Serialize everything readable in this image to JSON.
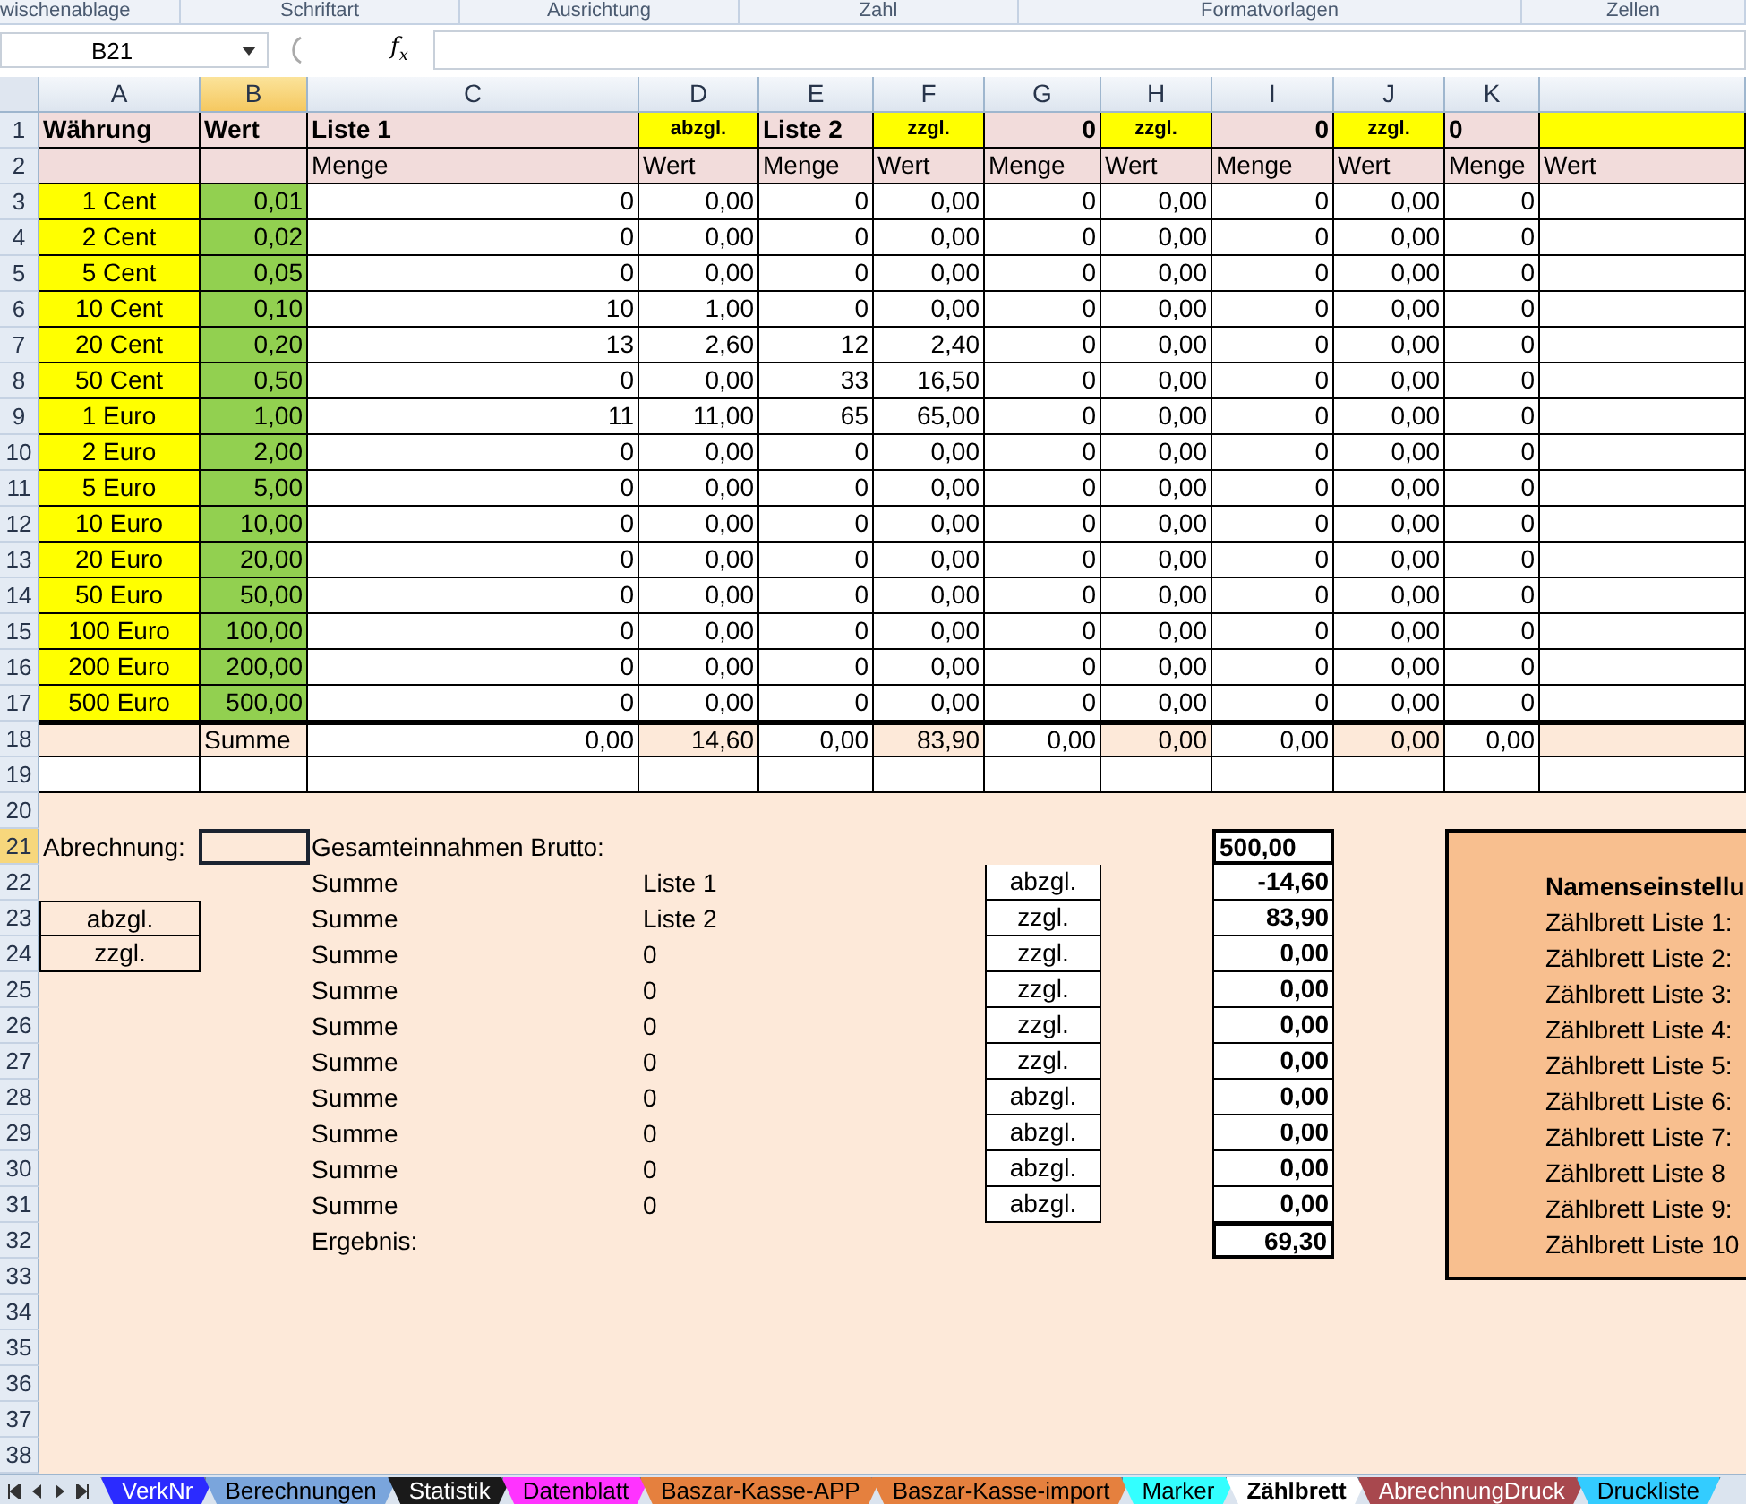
{
  "ribbon_groups": [
    "wischenablage",
    "Schriftart",
    "Ausrichtung",
    "Zahl",
    "Formatvorlagen",
    "Zellen"
  ],
  "name_box": "B21",
  "function_label": "f$_{x}$",
  "columns": [
    {
      "label": "A",
      "selected": false
    },
    {
      "label": "B",
      "selected": true
    },
    {
      "label": "C",
      "selected": false
    },
    {
      "label": "D",
      "selected": false
    },
    {
      "label": "E",
      "selected": false
    },
    {
      "label": "F",
      "selected": false
    },
    {
      "label": "G",
      "selected": false
    },
    {
      "label": "H",
      "selected": false
    },
    {
      "label": "I",
      "selected": false
    },
    {
      "label": "J",
      "selected": false
    },
    {
      "label": "K",
      "selected": false
    }
  ],
  "row_numbers": [
    {
      "label": "1",
      "selected": false
    },
    {
      "label": "2",
      "selected": false
    },
    {
      "label": "3",
      "selected": false
    },
    {
      "label": "4",
      "selected": false
    },
    {
      "label": "5",
      "selected": false
    },
    {
      "label": "6",
      "selected": false
    },
    {
      "label": "7",
      "selected": false
    },
    {
      "label": "8",
      "selected": false
    },
    {
      "label": "9",
      "selected": false
    },
    {
      "label": "10",
      "selected": false
    },
    {
      "label": "11",
      "selected": false
    },
    {
      "label": "12",
      "selected": false
    },
    {
      "label": "13",
      "selected": false
    },
    {
      "label": "14",
      "selected": false
    },
    {
      "label": "15",
      "selected": false
    },
    {
      "label": "16",
      "selected": false
    },
    {
      "label": "17",
      "selected": false
    },
    {
      "label": "18",
      "selected": false
    },
    {
      "label": "19",
      "selected": false
    },
    {
      "label": "20",
      "selected": false
    },
    {
      "label": "21",
      "selected": true
    },
    {
      "label": "22",
      "selected": false
    },
    {
      "label": "23",
      "selected": false
    },
    {
      "label": "24",
      "selected": false
    },
    {
      "label": "25",
      "selected": false
    },
    {
      "label": "26",
      "selected": false
    },
    {
      "label": "27",
      "selected": false
    },
    {
      "label": "28",
      "selected": false
    },
    {
      "label": "29",
      "selected": false
    },
    {
      "label": "30",
      "selected": false
    },
    {
      "label": "31",
      "selected": false
    },
    {
      "label": "32",
      "selected": false
    },
    {
      "label": "33",
      "selected": false
    },
    {
      "label": "34",
      "selected": false
    },
    {
      "label": "35",
      "selected": false
    },
    {
      "label": "36",
      "selected": false
    },
    {
      "label": "37",
      "selected": false
    },
    {
      "label": "38",
      "selected": false
    }
  ],
  "header_row": [
    {
      "text": "Währung",
      "kind": "head"
    },
    {
      "text": "Wert",
      "kind": "head"
    },
    {
      "text": "Liste 1",
      "kind": "head"
    },
    {
      "text": "abzgl.",
      "kind": "tag"
    },
    {
      "text": "Liste 2",
      "kind": "head"
    },
    {
      "text": "zzgl.",
      "kind": "tag"
    },
    {
      "text": "0",
      "kind": "count"
    },
    {
      "text": "zzgl.",
      "kind": "tag"
    },
    {
      "text": "0",
      "kind": "count"
    },
    {
      "text": "zzgl.",
      "kind": "tag"
    },
    {
      "text": "0",
      "kind": "head"
    },
    {
      "kind": "tag"
    }
  ],
  "subheader_row": [
    "Menge",
    "Wert",
    "Menge",
    "Wert",
    "Menge",
    "Wert",
    "Menge",
    "Wert",
    "Menge",
    "Wert"
  ],
  "currency_rows": [
    {
      "currency": "1 Cent",
      "value": "0,01",
      "cells": [
        "0",
        "0,00",
        "0",
        "0,00",
        "0",
        "0,00",
        "0",
        "0,00",
        "0"
      ]
    },
    {
      "currency": "2 Cent",
      "value": "0,02",
      "cells": [
        "0",
        "0,00",
        "0",
        "0,00",
        "0",
        "0,00",
        "0",
        "0,00",
        "0"
      ]
    },
    {
      "currency": "5 Cent",
      "value": "0,05",
      "cells": [
        "0",
        "0,00",
        "0",
        "0,00",
        "0",
        "0,00",
        "0",
        "0,00",
        "0"
      ]
    },
    {
      "currency": "10 Cent",
      "value": "0,10",
      "cells": [
        "10",
        "1,00",
        "0",
        "0,00",
        "0",
        "0,00",
        "0",
        "0,00",
        "0"
      ]
    },
    {
      "currency": "20 Cent",
      "value": "0,20",
      "cells": [
        "13",
        "2,60",
        "12",
        "2,40",
        "0",
        "0,00",
        "0",
        "0,00",
        "0"
      ]
    },
    {
      "currency": "50 Cent",
      "value": "0,50",
      "cells": [
        "0",
        "0,00",
        "33",
        "16,50",
        "0",
        "0,00",
        "0",
        "0,00",
        "0"
      ]
    },
    {
      "currency": "1 Euro",
      "value": "1,00",
      "cells": [
        "11",
        "11,00",
        "65",
        "65,00",
        "0",
        "0,00",
        "0",
        "0,00",
        "0"
      ]
    },
    {
      "currency": "2 Euro",
      "value": "2,00",
      "cells": [
        "0",
        "0,00",
        "0",
        "0,00",
        "0",
        "0,00",
        "0",
        "0,00",
        "0"
      ]
    },
    {
      "currency": "5 Euro",
      "value": "5,00",
      "cells": [
        "0",
        "0,00",
        "0",
        "0,00",
        "0",
        "0,00",
        "0",
        "0,00",
        "0"
      ]
    },
    {
      "currency": "10 Euro",
      "value": "10,00",
      "cells": [
        "0",
        "0,00",
        "0",
        "0,00",
        "0",
        "0,00",
        "0",
        "0,00",
        "0"
      ]
    },
    {
      "currency": "20 Euro",
      "value": "20,00",
      "cells": [
        "0",
        "0,00",
        "0",
        "0,00",
        "0",
        "0,00",
        "0",
        "0,00",
        "0"
      ]
    },
    {
      "currency": "50 Euro",
      "value": "50,00",
      "cells": [
        "0",
        "0,00",
        "0",
        "0,00",
        "0",
        "0,00",
        "0",
        "0,00",
        "0"
      ]
    },
    {
      "currency": "100 Euro",
      "value": "100,00",
      "cells": [
        "0",
        "0,00",
        "0",
        "0,00",
        "0",
        "0,00",
        "0",
        "0,00",
        "0"
      ]
    },
    {
      "currency": "200 Euro",
      "value": "200,00",
      "cells": [
        "0",
        "0,00",
        "0",
        "0,00",
        "0",
        "0,00",
        "0",
        "0,00",
        "0"
      ]
    },
    {
      "currency": "500 Euro",
      "value": "500,00",
      "cells": [
        "0",
        "0,00",
        "0",
        "0,00",
        "0",
        "0,00",
        "0",
        "0,00",
        "0"
      ]
    }
  ],
  "sum_row": {
    "label": "Summe",
    "cells": [
      "0,00",
      "14,60",
      "0,00",
      "83,90",
      "0,00",
      "0,00",
      "0,00",
      "0,00",
      "0,00"
    ]
  },
  "settlement": {
    "label": "Abrechnung:",
    "options": [
      "abzgl.",
      "zzgl."
    ],
    "gross_label": "Gesamteinnahmen Brutto:",
    "gross_total": "500,00",
    "lines": [
      {
        "label": "Summe",
        "list": "Liste 1",
        "mode": "abzgl.",
        "amount": "-14,60"
      },
      {
        "label": "Summe",
        "list": "Liste 2",
        "mode": "zzgl.",
        "amount": "83,90"
      },
      {
        "label": "Summe",
        "list": "0",
        "mode": "zzgl.",
        "amount": "0,00"
      },
      {
        "label": "Summe",
        "list": "0",
        "mode": "zzgl.",
        "amount": "0,00"
      },
      {
        "label": "Summe",
        "list": "0",
        "mode": "zzgl.",
        "amount": "0,00"
      },
      {
        "label": "Summe",
        "list": "0",
        "mode": "zzgl.",
        "amount": "0,00"
      },
      {
        "label": "Summe",
        "list": "0",
        "mode": "abzgl.",
        "amount": "0,00"
      },
      {
        "label": "Summe",
        "list": "0",
        "mode": "abzgl.",
        "amount": "0,00"
      },
      {
        "label": "Summe",
        "list": "0",
        "mode": "abzgl.",
        "amount": "0,00"
      },
      {
        "label": "Summe",
        "list": "0",
        "mode": "abzgl.",
        "amount": "0,00"
      }
    ],
    "result_label": "Ergebnis:",
    "result": "69,30"
  },
  "name_panel": {
    "title": "Namenseinstellu",
    "items": [
      "Zählbrett Liste 1:",
      "Zählbrett Liste 2:",
      "Zählbrett Liste 3:",
      "Zählbrett Liste 4:",
      "Zählbrett Liste 5:",
      "Zählbrett Liste 6:",
      "Zählbrett Liste 7:",
      "Zählbrett Liste 8",
      "Zählbrett Liste 9:",
      "Zählbrett Liste 10"
    ]
  },
  "sheet_tabs": [
    {
      "label": "VerkNr",
      "color": "#2b2bff",
      "selected": false
    },
    {
      "label": "Berechnungen",
      "color": "#7aa5dc",
      "selected": false
    },
    {
      "label": "Statistik",
      "color": "#1a1a1a",
      "selected": false
    },
    {
      "label": "Datenblatt",
      "color": "#ff33ff",
      "selected": false
    },
    {
      "label": "Baszar-Kasse-APP",
      "color": "#e5803e",
      "selected": false
    },
    {
      "label": "Baszar-Kasse-import",
      "color": "#e5803e",
      "selected": false
    },
    {
      "label": "Marker",
      "color": "#33ffff",
      "selected": false
    },
    {
      "label": "Zählbrett",
      "color": "#ffffff",
      "selected": true
    },
    {
      "label": "AbrechnungDruck",
      "color": "#a8484e",
      "selected": false
    },
    {
      "label": "Druckliste",
      "color": "#33ccff",
      "selected": false
    }
  ]
}
